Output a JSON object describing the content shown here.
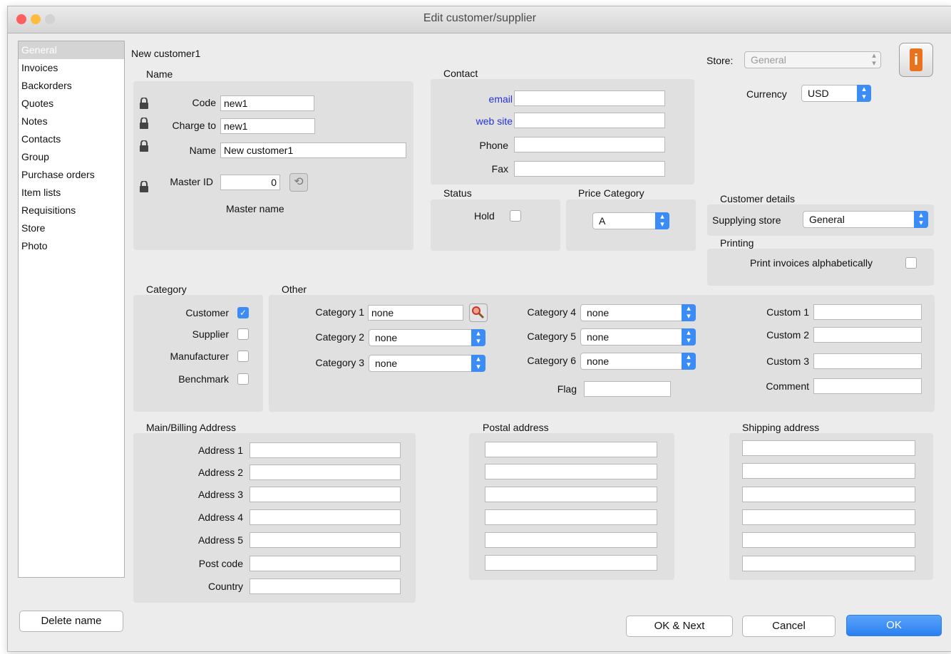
{
  "window": {
    "title": "Edit customer/supplier"
  },
  "sidebar": {
    "items": [
      {
        "label": "General",
        "selected": true
      },
      {
        "label": "Invoices"
      },
      {
        "label": "Backorders"
      },
      {
        "label": "Quotes"
      },
      {
        "label": "Notes"
      },
      {
        "label": "Contacts"
      },
      {
        "label": "Group"
      },
      {
        "label": "Purchase orders"
      },
      {
        "label": "Item lists"
      },
      {
        "label": "Requisitions"
      },
      {
        "label": "Store"
      },
      {
        "label": "Photo"
      }
    ],
    "delete_label": "Delete name"
  },
  "heading": "New customer1",
  "name_section": {
    "title": "Name",
    "code_label": "Code",
    "code_value": "new1",
    "charge_label": "Charge to",
    "charge_value": "new1",
    "name_label": "Name",
    "name_value": "New customer1",
    "master_id_label": "Master ID",
    "master_id_value": "0",
    "master_name_label": "Master name"
  },
  "contact": {
    "title": "Contact",
    "email_label": "email",
    "website_label": "web site",
    "phone_label": "Phone",
    "fax_label": "Fax",
    "email_value": "",
    "website_value": "",
    "phone_value": "",
    "fax_value": ""
  },
  "status": {
    "title": "Status",
    "hold_label": "Hold",
    "hold_checked": false
  },
  "price_category": {
    "title": "Price Category",
    "value": "A"
  },
  "store": {
    "label": "Store:",
    "value": "General"
  },
  "currency": {
    "label": "Currency",
    "value": "USD"
  },
  "customer_details": {
    "title": "Customer details",
    "supplying_label": "Supplying store",
    "supplying_value": "General"
  },
  "printing": {
    "title": "Printing",
    "alpha_label": "Print invoices alphabetically",
    "alpha_checked": false
  },
  "category": {
    "title": "Category",
    "customer_label": "Customer",
    "customer_checked": true,
    "supplier_label": "Supplier",
    "supplier_checked": false,
    "manufacturer_label": "Manufacturer",
    "manufacturer_checked": false,
    "benchmark_label": "Benchmark",
    "benchmark_checked": false
  },
  "other": {
    "title": "Other",
    "cat1_label": "Category 1",
    "cat1_value": "none",
    "cat2_label": "Category 2",
    "cat2_value": "none",
    "cat3_label": "Category 3",
    "cat3_value": "none",
    "cat4_label": "Category 4",
    "cat4_value": "none",
    "cat5_label": "Category 5",
    "cat5_value": "none",
    "cat6_label": "Category 6",
    "cat6_value": "none",
    "flag_label": "Flag",
    "flag_value": "",
    "custom1_label": "Custom 1",
    "custom2_label": "Custom 2",
    "custom3_label": "Custom 3",
    "comment_label": "Comment"
  },
  "billing": {
    "title": "Main/Billing Address",
    "labels": [
      "Address 1",
      "Address 2",
      "Address 3",
      "Address 4",
      "Address 5",
      "Post code",
      "Country"
    ]
  },
  "postal": {
    "title": "Postal address"
  },
  "shipping": {
    "title": "Shipping address"
  },
  "buttons": {
    "ok_next": "OK & Next",
    "cancel": "Cancel",
    "ok": "OK"
  },
  "colors": {
    "accent": "#3b8cf6",
    "link": "#2433d6",
    "close": "#fc605c",
    "minimize": "#fdbc40",
    "zoom": "#d2d2d2",
    "info_icon": "#e8731e"
  }
}
